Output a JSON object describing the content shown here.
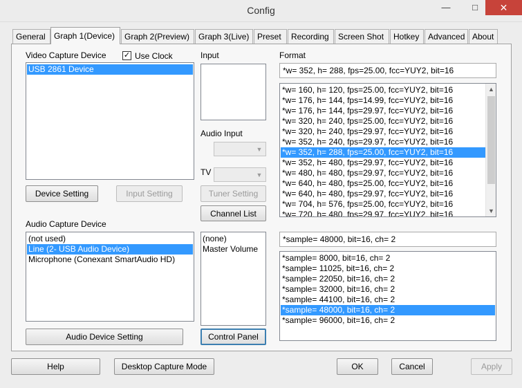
{
  "window": {
    "title": "Config",
    "minimize_glyph": "—",
    "maximize_glyph": "□",
    "close_glyph": "✕"
  },
  "tabs": [
    {
      "label": "General"
    },
    {
      "label": "Graph 1(Device)"
    },
    {
      "label": "Graph 2(Preview)"
    },
    {
      "label": "Graph 3(Live)"
    },
    {
      "label": "Preset"
    },
    {
      "label": "Recording"
    },
    {
      "label": "Screen Shot"
    },
    {
      "label": "Hotkey"
    },
    {
      "label": "Advanced"
    },
    {
      "label": "About"
    }
  ],
  "video": {
    "label": "Video Capture Device",
    "use_clock_label": "Use Clock",
    "use_clock_mark": "✓",
    "devices": [
      "USB 2861 Device"
    ],
    "device_setting": "Device Setting",
    "input_setting": "Input Setting"
  },
  "input": {
    "label": "Input",
    "audio_input_label": "Audio Input",
    "tv_label": "TV",
    "tuner_setting": "Tuner Setting",
    "channel_list": "Channel List"
  },
  "format": {
    "label": "Format",
    "current": "*w= 352, h= 288, fps=25.00,  fcc=YUY2, bit=16",
    "items": [
      "*w= 160, h= 120, fps=25.00,  fcc=YUY2, bit=16",
      "*w= 176, h= 144, fps=14.99,  fcc=YUY2, bit=16",
      "*w= 176, h= 144, fps=29.97,  fcc=YUY2, bit=16",
      "*w= 320, h= 240, fps=25.00,  fcc=YUY2, bit=16",
      "*w= 320, h= 240, fps=29.97,  fcc=YUY2, bit=16",
      "*w= 352, h= 240, fps=29.97,  fcc=YUY2, bit=16",
      "*w= 352, h= 288, fps=25.00,  fcc=YUY2, bit=16",
      "*w= 352, h= 480, fps=29.97,  fcc=YUY2, bit=16",
      "*w= 480, h= 480, fps=29.97,  fcc=YUY2, bit=16",
      "*w= 640, h= 480, fps=25.00,  fcc=YUY2, bit=16",
      "*w= 640, h= 480, fps=29.97,  fcc=YUY2, bit=16",
      "*w= 704, h= 576, fps=25.00,  fcc=YUY2, bit=16",
      "*w= 720, h= 480, fps=29.97,  fcc=YUY2, bit=16"
    ],
    "selected_index": 6
  },
  "audio": {
    "label": "Audio Capture Device",
    "devices": [
      "(not used)",
      "Line (2- USB Audio Device)",
      "Microphone (Conexant SmartAudio HD)"
    ],
    "selected_index": 1,
    "device_setting": "Audio Device Setting",
    "mixer_items": [
      "(none)",
      "Master Volume"
    ],
    "control_panel": "Control Panel",
    "format_current": "*sample= 48000, bit=16, ch= 2",
    "format_items": [
      "*sample=  8000, bit=16, ch= 2",
      "*sample= 11025, bit=16, ch= 2",
      "*sample= 22050, bit=16, ch= 2",
      "*sample= 32000, bit=16, ch= 2",
      "*sample= 44100, bit=16, ch= 2",
      "*sample= 48000, bit=16, ch= 2",
      "*sample= 96000, bit=16, ch= 2"
    ],
    "format_selected_index": 5
  },
  "bottom": {
    "help": "Help",
    "desktop_capture": "Desktop Capture Mode",
    "ok": "OK",
    "cancel": "Cancel",
    "apply": "Apply"
  },
  "colors": {
    "selection": "#3399ff",
    "close_button": "#c7433a"
  }
}
